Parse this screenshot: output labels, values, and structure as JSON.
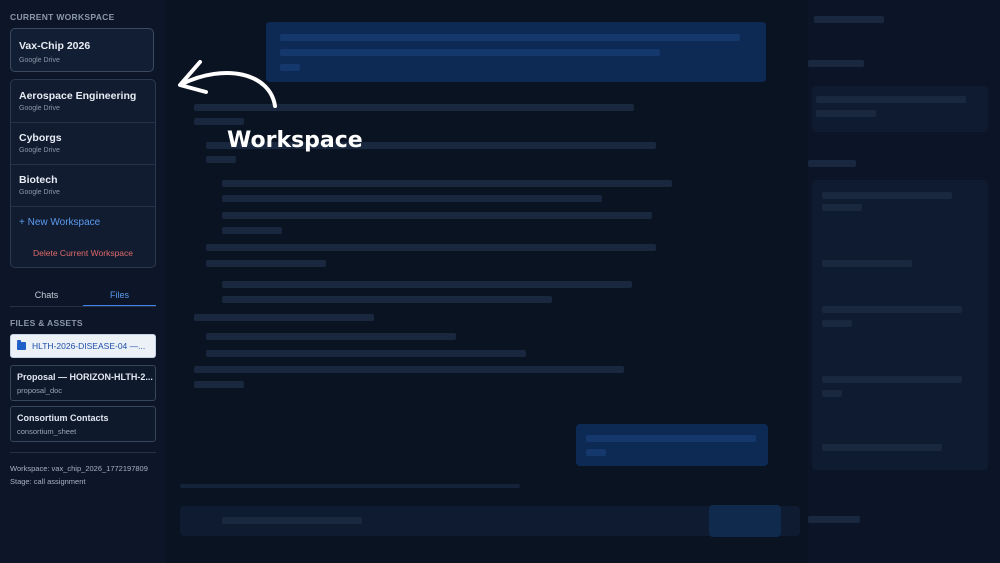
{
  "sidebar": {
    "current_workspace_title": "CURRENT WORKSPACE",
    "current": {
      "name": "Vax-Chip 2026",
      "source": "Google Drive"
    },
    "workspaces": [
      {
        "name": "Aerospace Engineering",
        "source": "Google Drive"
      },
      {
        "name": "Cyborgs",
        "source": "Google Drive"
      },
      {
        "name": "Biotech",
        "source": "Google Drive"
      }
    ],
    "new_workspace": "+ New Workspace",
    "delete_workspace": "Delete Current Workspace",
    "tabs": {
      "chats": "Chats",
      "files": "Files",
      "active": "Files"
    },
    "files_title": "FILES & ASSETS",
    "active_folder": "HLTH-2026-DISEASE-04 —...",
    "files": [
      {
        "title": "Proposal — HORIZON-HLTH-2...",
        "subtitle": "proposal_doc"
      },
      {
        "title": "Consortium Contacts",
        "subtitle": "consortium_sheet"
      }
    ],
    "workspace_meta": "Workspace: vax_chip_2026_1772197809",
    "stage_meta": "Stage: call assignment"
  },
  "overlay": {
    "label": "Workspace"
  },
  "colors": {
    "accent": "#3e82e6",
    "danger": "#e06a6a",
    "background": "#0b1426"
  }
}
